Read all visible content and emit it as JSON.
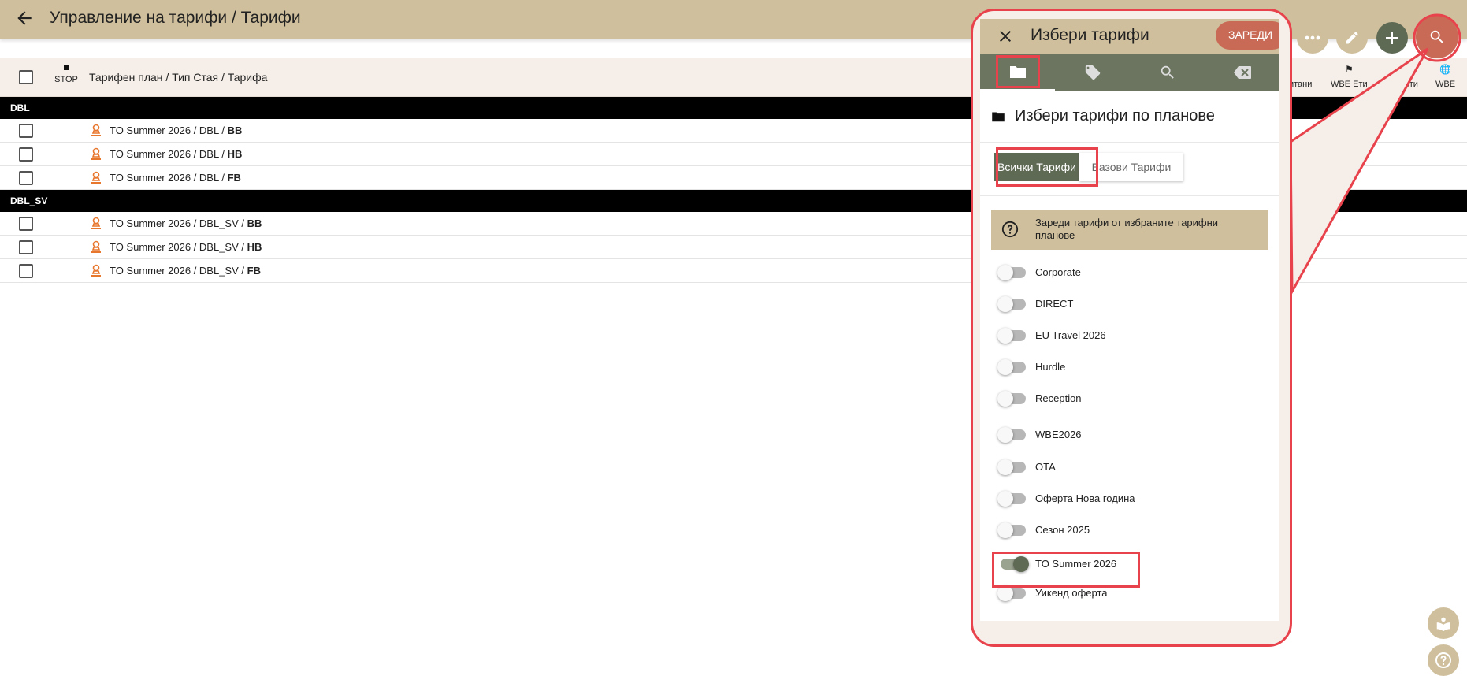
{
  "app": {
    "title": "Управление на тарифи / Тарифи"
  },
  "table": {
    "header": {
      "stop_label": "STOP",
      "column_title": "Тарифен план / Тип Стая / Тарифа",
      "right_columns": [
        {
          "icon": "list-icon",
          "label": "итани"
        },
        {
          "icon": "flag-icon",
          "label": "WBE Ети"
        },
        {
          "icon": "tag-icon",
          "label": "кети"
        },
        {
          "icon": "globe-icon",
          "label": "WBE"
        }
      ]
    },
    "groups": [
      {
        "name": "DBL",
        "rows": [
          {
            "prefix": "TO Summer 2026 / DBL / ",
            "rate": "BB"
          },
          {
            "prefix": "TO Summer 2026 / DBL / ",
            "rate": "HB"
          },
          {
            "prefix": "TO Summer 2026 / DBL / ",
            "rate": "FB"
          }
        ]
      },
      {
        "name": "DBL_SV",
        "rows": [
          {
            "prefix": "TO Summer 2026 / DBL_SV / ",
            "rate": "BB"
          },
          {
            "prefix": "TO Summer 2026 / DBL_SV / ",
            "rate": "HB"
          },
          {
            "prefix": "TO Summer 2026 / DBL_SV / ",
            "rate": "FB"
          }
        ]
      }
    ]
  },
  "toolbar": {
    "icons": [
      "more-icon",
      "edit-icon",
      "add-icon",
      "search-icon"
    ]
  },
  "panel": {
    "title": "Избери тарифи",
    "load_label": "ЗАРЕДИ",
    "tabs": [
      "folder-icon",
      "tag-icon",
      "search-icon",
      "backspace-icon"
    ],
    "section_title": "Избери тарифи по планове",
    "segments": {
      "all": "Всички Тарифи",
      "base": "Базови Тарифи"
    },
    "info": "Зареди тарифи от избраните тарифни планове",
    "plans": [
      {
        "label": "Corporate",
        "on": false
      },
      {
        "label": "DIRECT",
        "on": false
      },
      {
        "label": "EU Travel 2026",
        "on": false
      },
      {
        "label": "Hurdle",
        "on": false
      },
      {
        "label": "Reception",
        "on": false
      },
      {
        "label": "WBE2026",
        "on": false
      },
      {
        "label": "OTA",
        "on": false
      },
      {
        "label": "Оферта Нова година",
        "on": false
      },
      {
        "label": "Сезон 2025",
        "on": false
      },
      {
        "label": "TO Summer 2026",
        "on": true
      },
      {
        "label": "Уикенд оферта",
        "on": false
      }
    ]
  },
  "colors": {
    "topbar": "#cfbf9c",
    "accent_green": "#5f6a55",
    "accent_red": "#c86a55",
    "highlight": "#e8434c"
  }
}
